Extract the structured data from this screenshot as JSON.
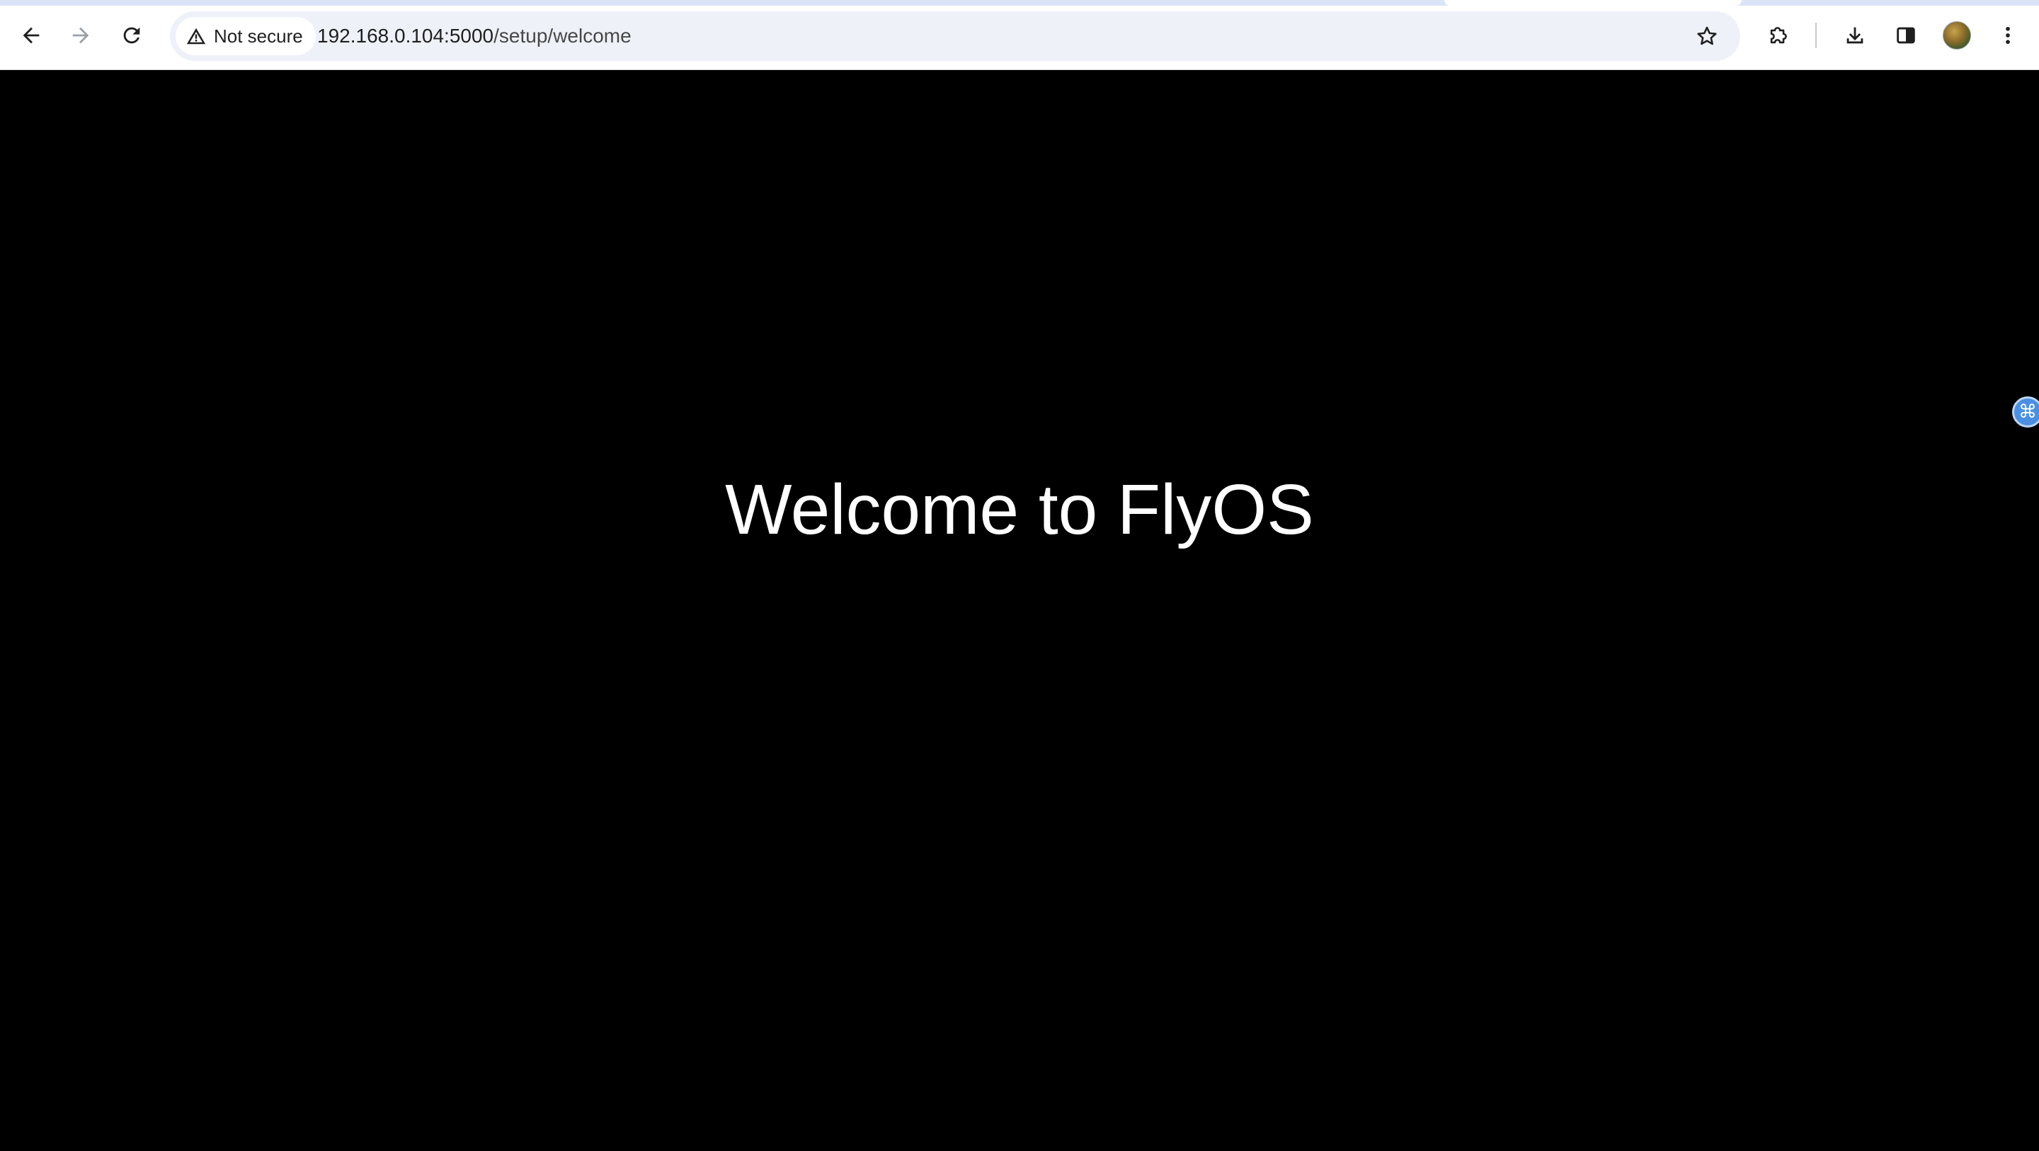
{
  "browser": {
    "security_label": "Not secure",
    "url_host": "192.168.0.104:5000",
    "url_path": "/setup/welcome",
    "icons": {
      "back": "back-arrow-icon",
      "forward": "forward-arrow-icon",
      "reload": "reload-icon",
      "security": "warning-triangle-icon",
      "bookmark": "star-icon",
      "extensions": "puzzle-piece-icon",
      "downloads": "download-icon",
      "side_panel": "side-panel-icon",
      "profile": "avatar",
      "menu": "kebab-menu-icon"
    }
  },
  "page": {
    "title": "Welcome to FlyOS",
    "background_color": "#000000",
    "text_color": "#ffffff"
  },
  "side_widget": {
    "glyph": "⌘",
    "accent_color": "#4a90e2"
  }
}
